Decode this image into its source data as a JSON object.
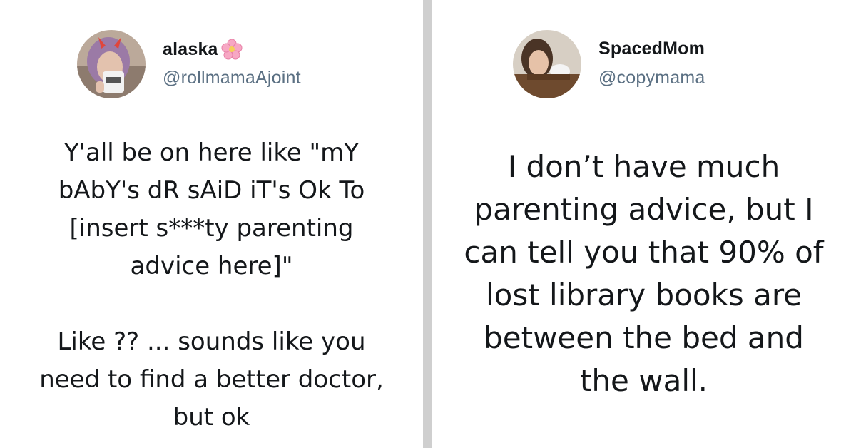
{
  "left_tweet": {
    "display_name": "alaska",
    "name_emoji": "cherry-blossom-icon",
    "handle": "@rollmamaAjoint",
    "paragraphs": [
      [
        "Y'all be on here like \"mY",
        "bAbY's dR sAiD iT's Ok To",
        "[insert s***ty parenting",
        "advice here]\""
      ],
      [
        "Like ?? ... sounds like you",
        "need to find a better doctor,",
        "but ok"
      ]
    ]
  },
  "right_tweet": {
    "display_name": "SpacedMom",
    "handle": "@copymama",
    "lines": [
      "I don’t have much",
      "parenting advice, but I",
      "can tell you that 90% of",
      "lost library books are",
      "between the bed and",
      "the wall."
    ]
  },
  "colors": {
    "text": "#14171a",
    "handle": "#5b7083",
    "divider": "#cfcfcf",
    "background": "#ffffff"
  }
}
